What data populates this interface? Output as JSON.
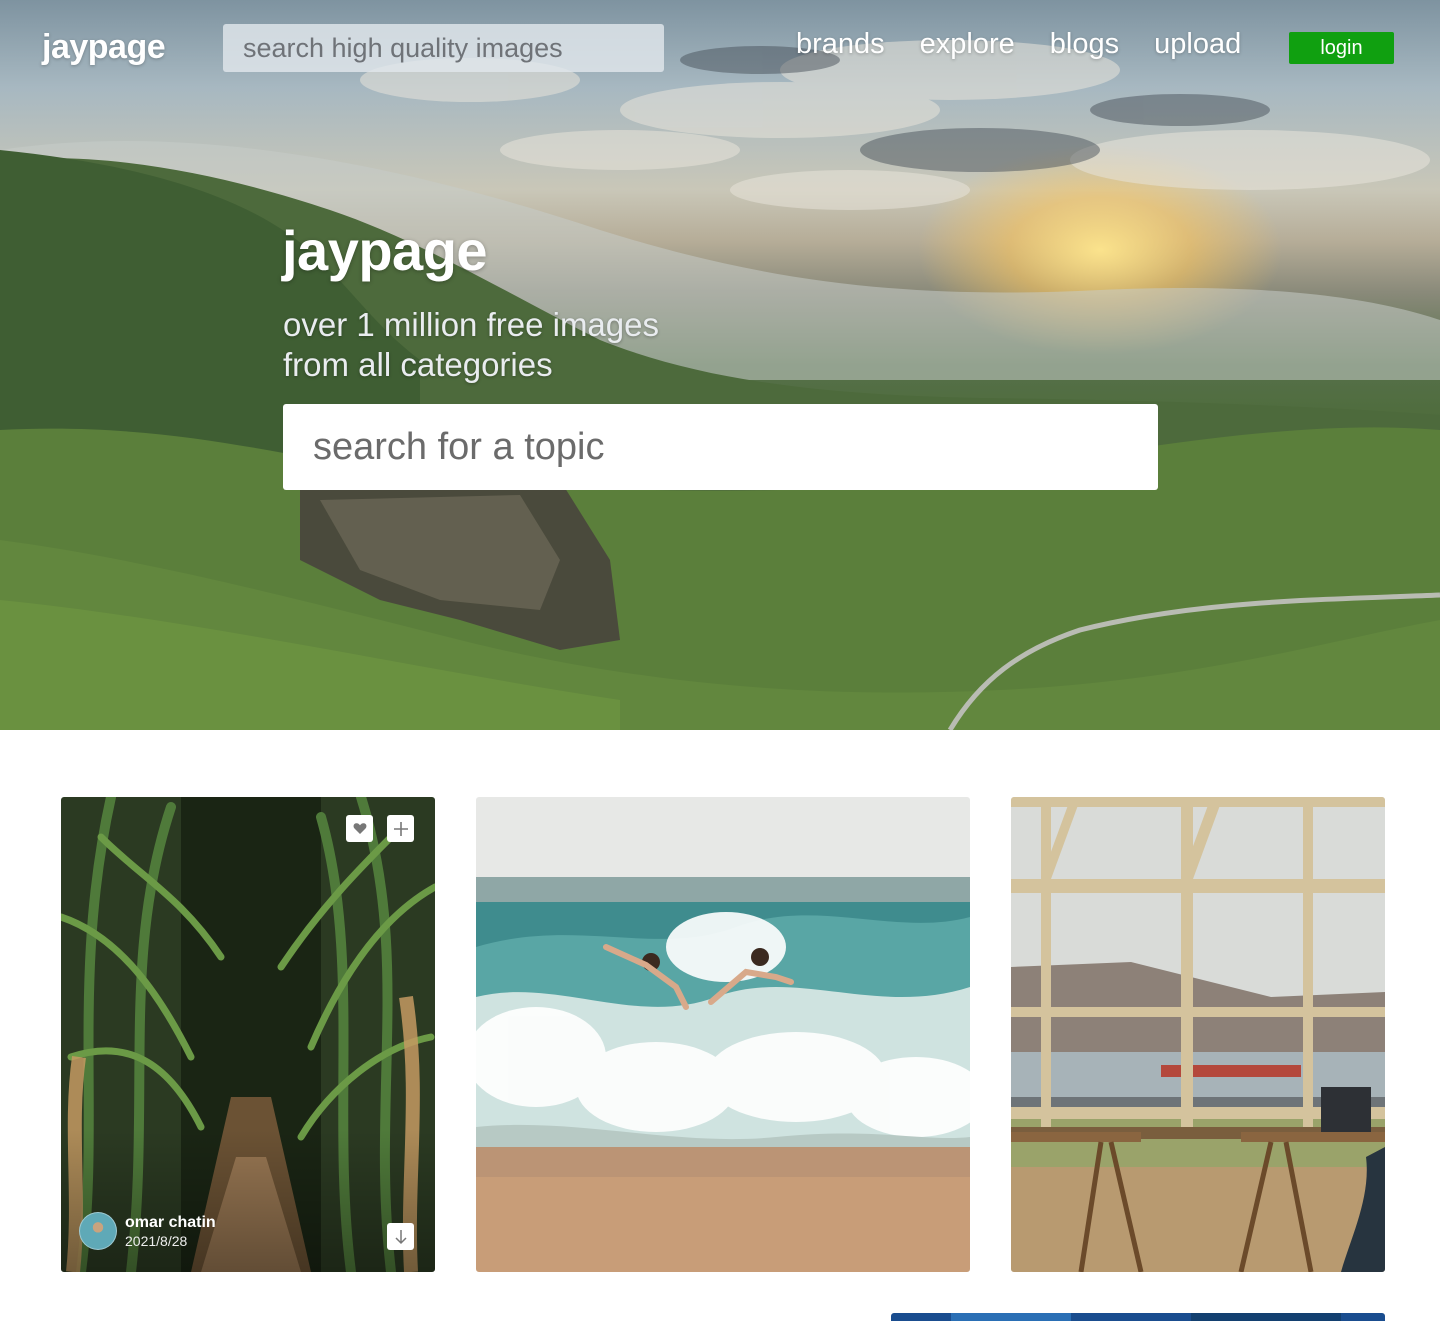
{
  "header": {
    "logo": "jaypage",
    "search_placeholder": "search high quality images",
    "nav": [
      {
        "label": "brands"
      },
      {
        "label": "explore"
      },
      {
        "label": "blogs"
      },
      {
        "label": "upload"
      }
    ],
    "login_label": "login",
    "login_color": "#10a010"
  },
  "hero": {
    "title": "jaypage",
    "subtitle_line1": "over 1 million free images",
    "subtitle_line2": "from all categories",
    "search_placeholder": "search for a topic"
  },
  "gallery": {
    "cards": [
      {
        "author": "omar chatin",
        "date": "2021/8/28",
        "icons": [
          "heart-icon",
          "plus-icon",
          "download-icon"
        ]
      }
    ]
  }
}
